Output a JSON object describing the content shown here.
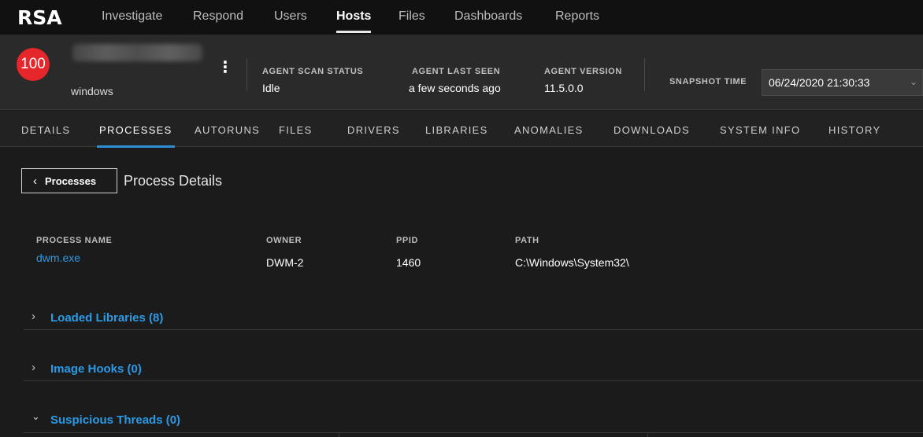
{
  "logo": "RSA",
  "nav": {
    "items": [
      {
        "label": "Investigate"
      },
      {
        "label": "Respond"
      },
      {
        "label": "Users"
      },
      {
        "label": "Hosts"
      },
      {
        "label": "Files"
      },
      {
        "label": "Dashboards"
      },
      {
        "label": "Reports"
      }
    ],
    "active": "Hosts"
  },
  "host": {
    "risk_score": "100",
    "os": "windows",
    "stats": [
      {
        "label": "AGENT SCAN STATUS",
        "value": "Idle"
      },
      {
        "label": "AGENT LAST SEEN",
        "value": "a few seconds ago"
      },
      {
        "label": "AGENT VERSION",
        "value": "11.5.0.0"
      }
    ],
    "snapshot_label": "SNAPSHOT TIME",
    "snapshot_value": "06/24/2020 21:30:33"
  },
  "tabs": {
    "items": [
      {
        "label": "DETAILS"
      },
      {
        "label": "PROCESSES"
      },
      {
        "label": "AUTORUNS"
      },
      {
        "label": "FILES"
      },
      {
        "label": "DRIVERS"
      },
      {
        "label": "LIBRARIES"
      },
      {
        "label": "ANOMALIES"
      },
      {
        "label": "DOWNLOADS"
      },
      {
        "label": "SYSTEM INFO"
      },
      {
        "label": "HISTORY"
      }
    ],
    "active": "PROCESSES"
  },
  "content": {
    "back_label": "Processes",
    "title": "Process Details",
    "fields": [
      {
        "label": "PROCESS NAME",
        "value": "dwm.exe"
      },
      {
        "label": "OWNER",
        "value": "DWM-2"
      },
      {
        "label": "PPID",
        "value": "1460"
      },
      {
        "label": "PATH",
        "value": "C:\\Windows\\System32\\"
      }
    ],
    "sections": [
      {
        "title": "Loaded Libraries (8)",
        "expanded": false
      },
      {
        "title": "Image Hooks (0)",
        "expanded": false
      },
      {
        "title": "Suspicious Threads (0)",
        "expanded": true
      }
    ]
  },
  "colors": {
    "accent_blue": "#2b9ae6",
    "risk_red": "#e5262b",
    "tab_underline": "#2c8fd6"
  }
}
